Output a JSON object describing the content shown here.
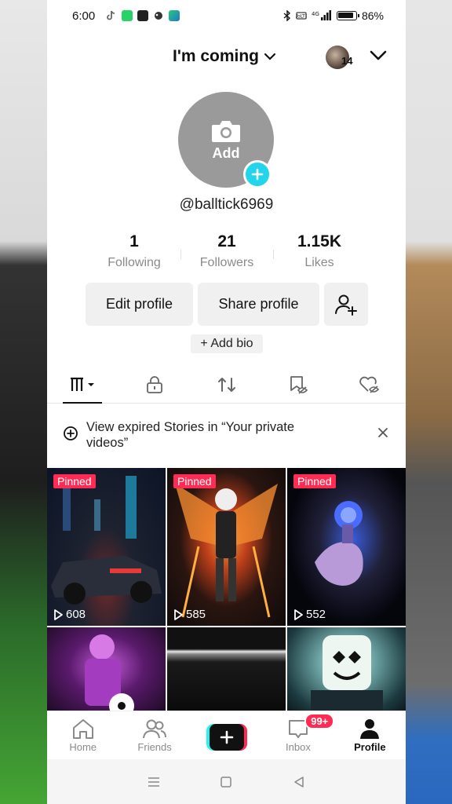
{
  "status_bar": {
    "time": "6:00",
    "battery": "86%",
    "network": "4G"
  },
  "header": {
    "account_name": "I'm coming",
    "notification_count": "14"
  },
  "profile": {
    "avatar_add_label": "Add",
    "username": "@balltick6969",
    "stats": [
      {
        "value": "1",
        "label": "Following"
      },
      {
        "value": "21",
        "label": "Followers"
      },
      {
        "value": "1.15K",
        "label": "Likes"
      }
    ],
    "edit_profile_label": "Edit profile",
    "share_profile_label": "Share profile",
    "add_bio_label": "+ Add bio"
  },
  "tabs": [
    {
      "icon": "videos-grid-icon",
      "active": true
    },
    {
      "icon": "lock-icon",
      "active": false
    },
    {
      "icon": "repost-icon",
      "active": false
    },
    {
      "icon": "favorites-hidden-icon",
      "active": false
    },
    {
      "icon": "liked-hidden-icon",
      "active": false
    }
  ],
  "banner": {
    "text": "View expired Stories in “Your private videos”"
  },
  "videos": [
    {
      "pinned": "Pinned",
      "views": "608"
    },
    {
      "pinned": "Pinned",
      "views": "585"
    },
    {
      "pinned": "Pinned",
      "views": "552"
    },
    {
      "pinned": "",
      "views": ""
    },
    {
      "pinned": "",
      "views": ""
    },
    {
      "pinned": "",
      "views": ""
    }
  ],
  "bottom_nav": {
    "home": "Home",
    "friends": "Friends",
    "inbox": "Inbox",
    "inbox_badge": "99+",
    "profile": "Profile"
  },
  "colors": {
    "accent_red": "#fe2c55",
    "accent_cyan": "#20d5ec"
  }
}
